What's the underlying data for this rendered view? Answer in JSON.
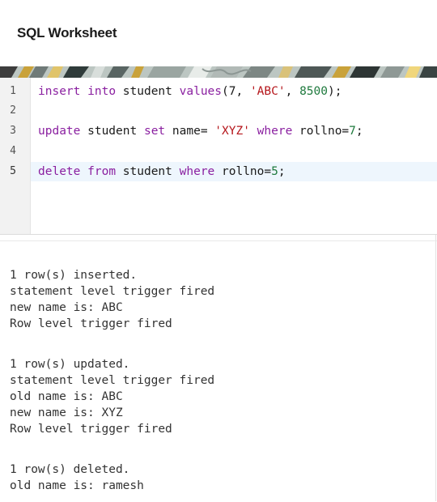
{
  "header": {
    "title": "SQL Worksheet"
  },
  "editor": {
    "line_numbers": [
      "1",
      "2",
      "3",
      "4",
      "5"
    ],
    "active_line": 5,
    "lines": {
      "l1": {
        "kw1": "insert",
        "kw2": "into",
        "t1": " student ",
        "kw3": "values",
        "t2": "(7, ",
        "str": "'ABC'",
        "t3": ", ",
        "num": "8500",
        "t4": ");"
      },
      "l3": {
        "kw1": "update",
        "t1": " student ",
        "kw2": "set",
        "t2": " name= ",
        "str": "'XYZ'",
        "kw3": "where",
        "t3": " rollno=",
        "num": "7",
        "t4": ";"
      },
      "l5": {
        "kw1": "delete",
        "kw2": "from",
        "t1": " student ",
        "kw3": "where",
        "t2": " rollno=",
        "num": "5",
        "t3": ";"
      }
    }
  },
  "output": {
    "blocks": [
      [
        "1 row(s) inserted.",
        "statement level trigger fired",
        "new name is: ABC",
        "Row level trigger fired"
      ],
      [
        "1 row(s) updated.",
        "statement level trigger fired",
        "old name is: ABC",
        "new name is: XYZ",
        "Row level trigger fired"
      ],
      [
        "1 row(s) deleted.",
        "old name is: ramesh"
      ]
    ]
  }
}
